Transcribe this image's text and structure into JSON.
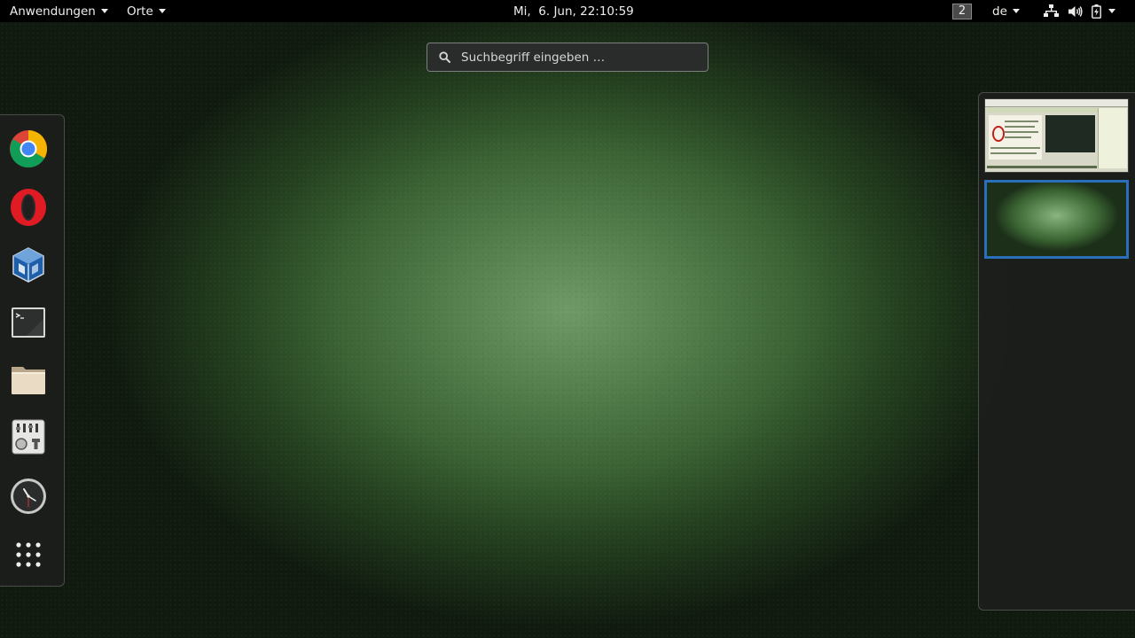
{
  "topbar": {
    "activities_menu": "Anwendungen",
    "places_menu": "Orte",
    "clock": "Mi,  6. Jun, 22:10:59",
    "workspace_number": "2",
    "keyboard_layout": "de",
    "status_icons": [
      "network-wired-icon",
      "volume-icon",
      "battery-charging-icon",
      "chevron-down-icon"
    ]
  },
  "search": {
    "placeholder": "Suchbegriff eingeben …",
    "icon": "search-icon"
  },
  "dash": {
    "apps": [
      {
        "name": "Google Chrome",
        "icon": "chrome-icon"
      },
      {
        "name": "Opera",
        "icon": "opera-icon"
      },
      {
        "name": "VirtualBox",
        "icon": "virtualbox-icon"
      },
      {
        "name": "Terminal",
        "icon": "terminal-icon"
      },
      {
        "name": "Dateien",
        "icon": "folder-icon"
      },
      {
        "name": "Einstellungen",
        "icon": "settings-mixer-icon"
      },
      {
        "name": "Uhren",
        "icon": "clock-icon"
      },
      {
        "name": "Anwendungen anzeigen",
        "icon": "show-apps-grid-icon"
      }
    ]
  },
  "workspaces": {
    "count": 2,
    "active_index": 1,
    "accent_color": "#2a6fba"
  },
  "colors": {
    "topbar_bg": "#000000",
    "wallpaper_center": "#6f9a67",
    "wallpaper_edge": "#101a0f"
  }
}
